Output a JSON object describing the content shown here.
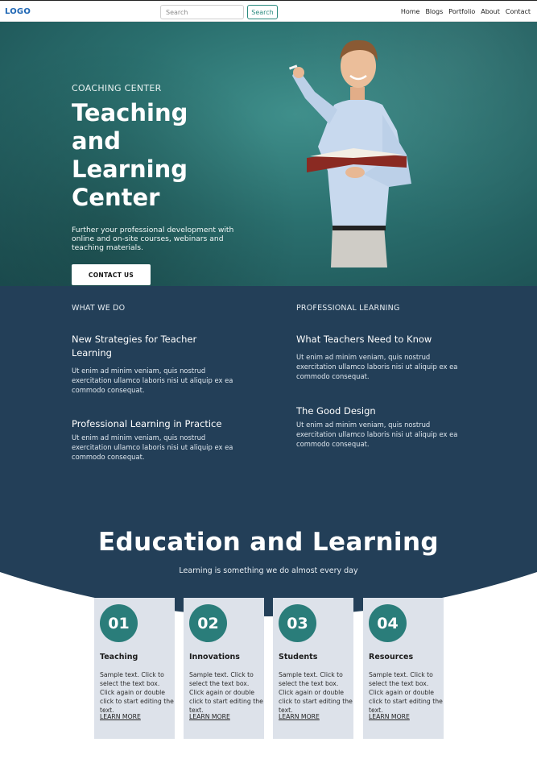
{
  "nav": {
    "logo": "LOGO",
    "search_placeholder": "Search",
    "search_button": "Search",
    "links": [
      "Home",
      "Blogs",
      "Portfolio",
      "About",
      "Contact"
    ]
  },
  "hero": {
    "eyebrow": "COACHING CENTER",
    "title": "Teaching and Learning Center",
    "description": "Further your professional development with online and on-site courses, webinars and teaching materials.",
    "cta": "CONTACT US"
  },
  "what_we_do": {
    "left_heading": "WHAT WE DO",
    "right_heading": "PROFESSIONAL LEARNING",
    "items": [
      {
        "title": "New Strategies for Teacher Learning",
        "text": "Ut enim ad minim veniam, quis nostrud exercitation ullamco laboris nisi ut aliquip ex ea commodo consequat."
      },
      {
        "title": "Professional Learning in Practice",
        "text": "Ut enim ad minim veniam, quis nostrud exercitation ullamco laboris nisi ut aliquip ex ea commodo consequat."
      },
      {
        "title": "What Teachers Need to Know",
        "text": "Ut enim ad minim veniam, quis nostrud exercitation ullamco laboris nisi ut aliquip ex ea commodo consequat."
      },
      {
        "title": "The Good Design",
        "text": "Ut enim ad minim veniam, quis nostrud exercitation ullamco laboris nisi ut aliquip ex ea commodo consequat."
      }
    ]
  },
  "education": {
    "title": "Education and Learning",
    "subtitle": "Learning is something we do almost every day",
    "cards": [
      {
        "number": "01",
        "title": "Teaching",
        "text": "Sample text. Click to select the text box. Click again or double click to start editing the text.",
        "link": "LEARN MORE"
      },
      {
        "number": "02",
        "title": "Innovations",
        "text": "Sample text. Click to select the text box. Click again or double click to start editing the text.",
        "link": "LEARN MORE"
      },
      {
        "number": "03",
        "title": "Students",
        "text": "Sample text. Click to select the text box. Click again or double click to start editing the text.",
        "link": "LEARN MORE"
      },
      {
        "number": "04",
        "title": "Resources",
        "text": "Sample text. Click to select the text box. Click again or double click to start editing the text.",
        "link": "LEARN MORE"
      }
    ]
  },
  "colors": {
    "brand_blue": "#1e66b4",
    "accent_teal": "#2a7d7a",
    "dark_navy": "#233f58",
    "card_bg": "#dde2ea"
  }
}
